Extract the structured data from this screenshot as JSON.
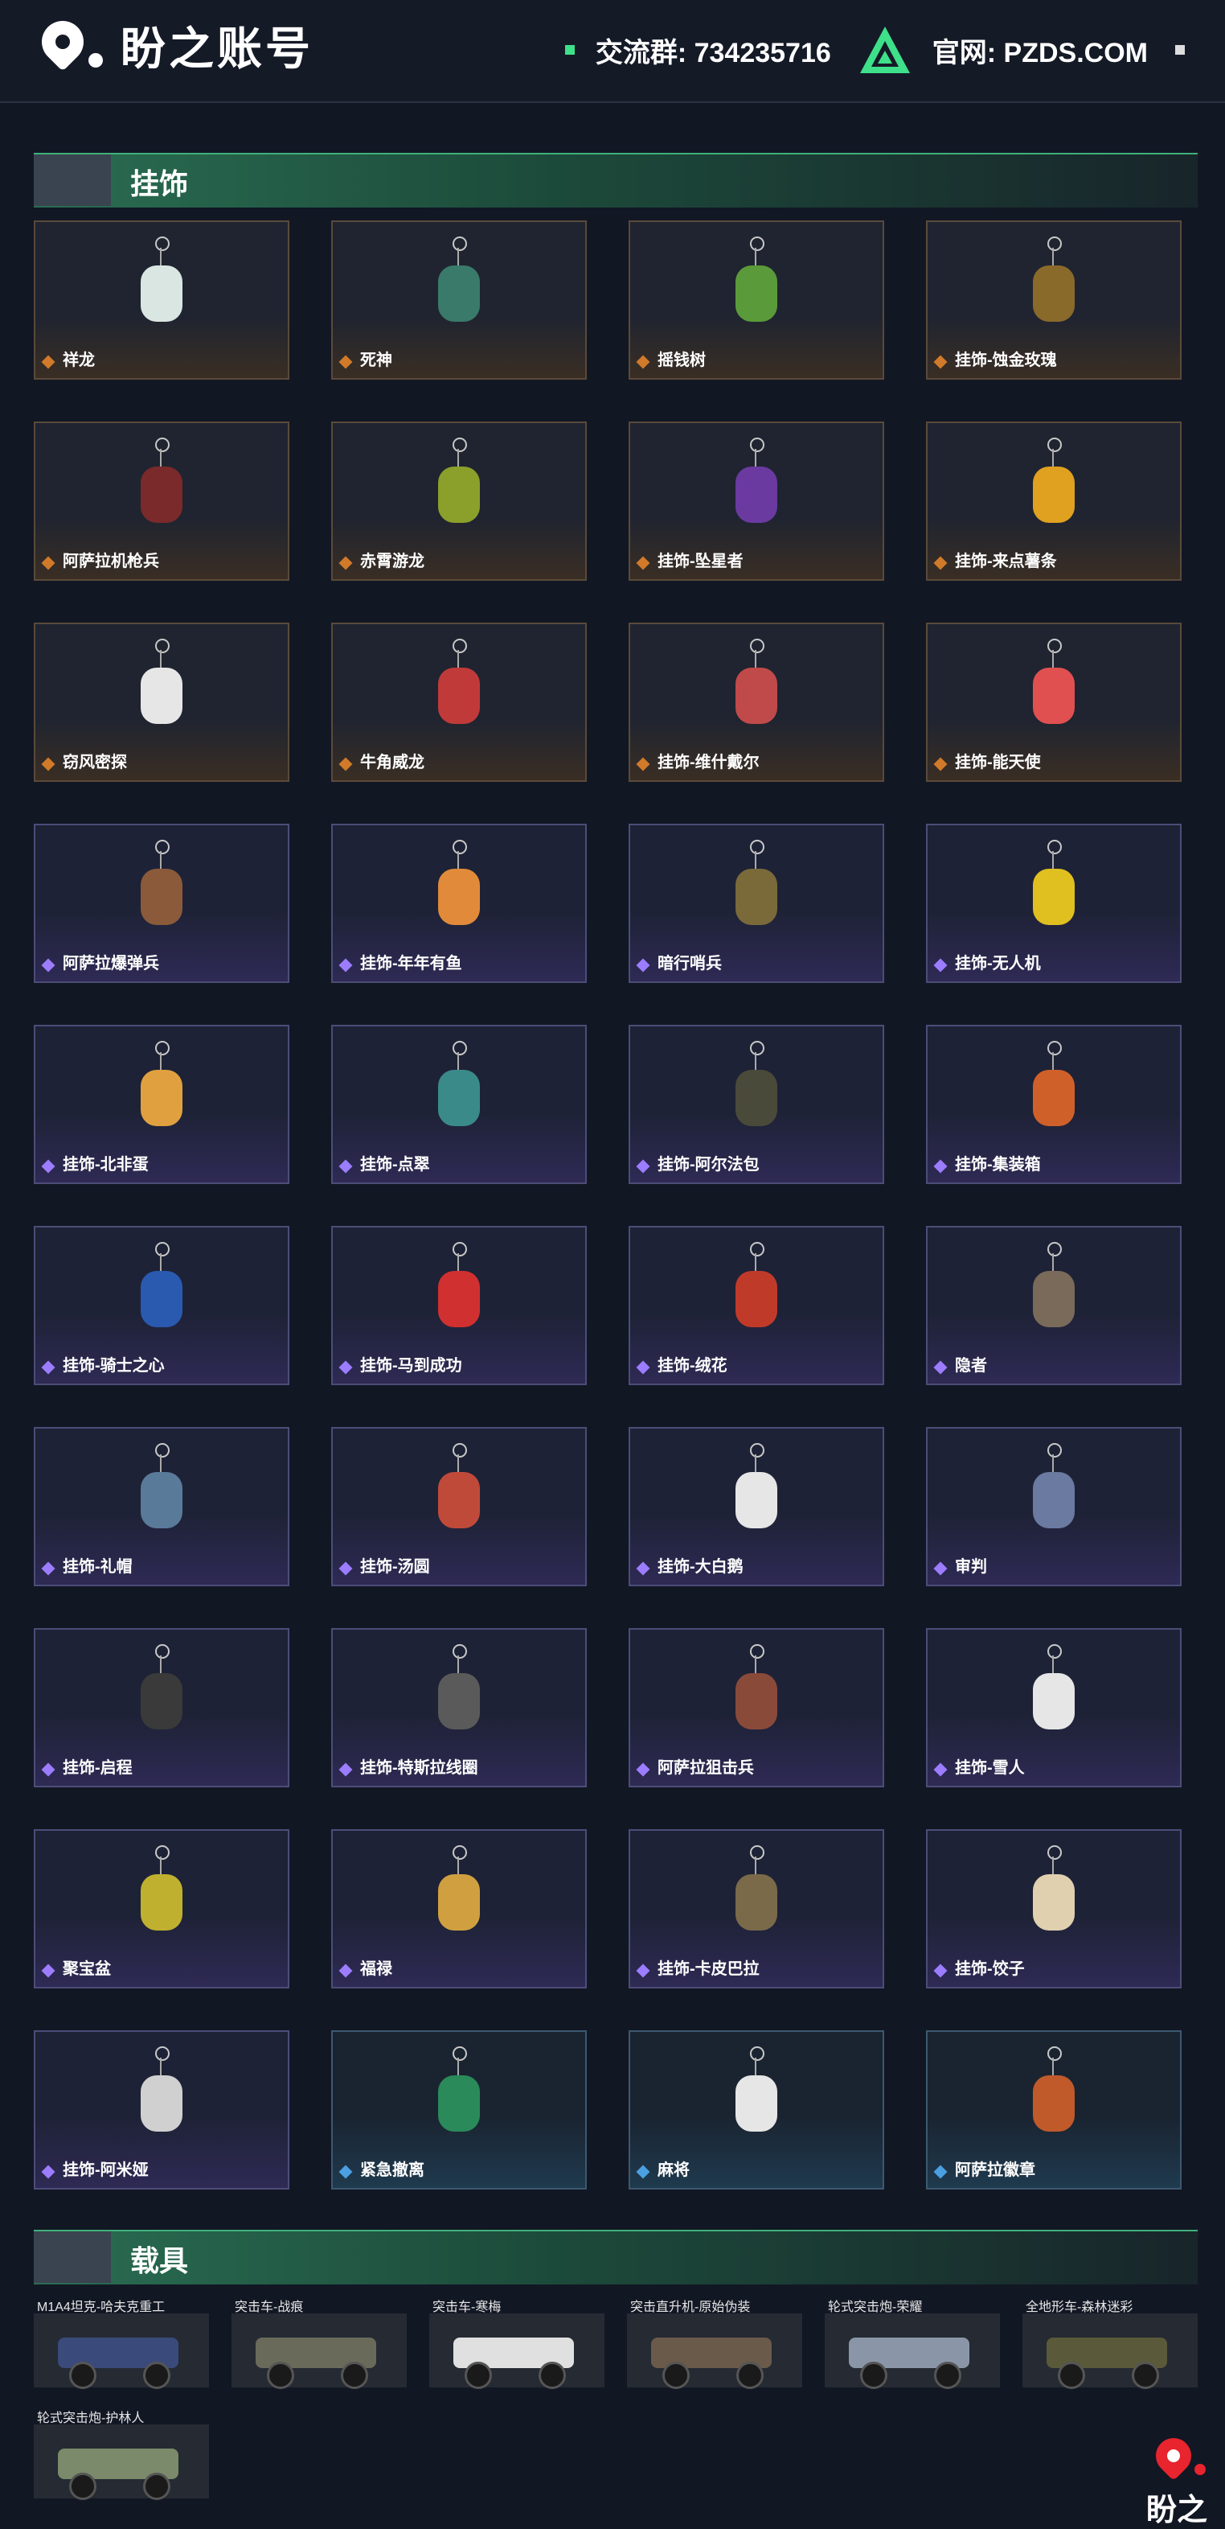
{
  "header": {
    "brand": "盼之账号",
    "group_label": "交流群: 734235716",
    "site_label": "官网: PZDS.COM"
  },
  "sections": {
    "charms_title": "挂饰",
    "vehicles_title": "载具"
  },
  "charms": [
    {
      "name": "祥龙",
      "rarity": "gold",
      "color": "#d9e6e2"
    },
    {
      "name": "死神",
      "rarity": "gold",
      "color": "#3a7a6a"
    },
    {
      "name": "摇钱树",
      "rarity": "gold",
      "color": "#5a9a3a"
    },
    {
      "name": "挂饰-蚀金玫瑰",
      "rarity": "gold",
      "color": "#8a6a2a"
    },
    {
      "name": "阿萨拉机枪兵",
      "rarity": "gold",
      "color": "#7a2a2a"
    },
    {
      "name": "赤霄游龙",
      "rarity": "gold",
      "color": "#8aa02a"
    },
    {
      "name": "挂饰-坠星者",
      "rarity": "gold",
      "color": "#6a3aa0"
    },
    {
      "name": "挂饰-来点薯条",
      "rarity": "gold",
      "color": "#e0a020"
    },
    {
      "name": "窃风密探",
      "rarity": "gold",
      "color": "#e6e6e6"
    },
    {
      "name": "牛角威龙",
      "rarity": "gold",
      "color": "#c03a3a"
    },
    {
      "name": "挂饰-维什戴尔",
      "rarity": "gold",
      "color": "#c04a4a"
    },
    {
      "name": "挂饰-能天使",
      "rarity": "gold",
      "color": "#e05050"
    },
    {
      "name": "阿萨拉爆弹兵",
      "rarity": "purple",
      "color": "#8a5a3a"
    },
    {
      "name": "挂饰-年年有鱼",
      "rarity": "purple",
      "color": "#e08a3a"
    },
    {
      "name": "暗行哨兵",
      "rarity": "purple",
      "color": "#7a6a3a"
    },
    {
      "name": "挂饰-无人机",
      "rarity": "purple",
      "color": "#e0c020"
    },
    {
      "name": "挂饰-北非蛋",
      "rarity": "purple",
      "color": "#e0a040"
    },
    {
      "name": "挂饰-点翠",
      "rarity": "purple",
      "color": "#3a8a8a"
    },
    {
      "name": "挂饰-阿尔法包",
      "rarity": "purple",
      "color": "#4a4a3a"
    },
    {
      "name": "挂饰-集装箱",
      "rarity": "purple",
      "color": "#d0602a"
    },
    {
      "name": "挂饰-骑士之心",
      "rarity": "purple",
      "color": "#2a5ab0"
    },
    {
      "name": "挂饰-马到成功",
      "rarity": "purple",
      "color": "#d03030"
    },
    {
      "name": "挂饰-绒花",
      "rarity": "purple",
      "color": "#c03a2a"
    },
    {
      "name": "隐者",
      "rarity": "purple",
      "color": "#7a6a5a"
    },
    {
      "name": "挂饰-礼帽",
      "rarity": "purple",
      "color": "#5a7a9a"
    },
    {
      "name": "挂饰-汤圆",
      "rarity": "purple",
      "color": "#c04a3a"
    },
    {
      "name": "挂饰-大白鹅",
      "rarity": "purple",
      "color": "#e6e6e6"
    },
    {
      "name": "审判",
      "rarity": "purple",
      "color": "#6a7aa0"
    },
    {
      "name": "挂饰-启程",
      "rarity": "purple",
      "color": "#3a3a3a"
    },
    {
      "name": "挂饰-特斯拉线圈",
      "rarity": "purple",
      "color": "#5a5a5a"
    },
    {
      "name": "阿萨拉狙击兵",
      "rarity": "purple",
      "color": "#8a4a3a"
    },
    {
      "name": "挂饰-雪人",
      "rarity": "purple",
      "color": "#e6e6e6"
    },
    {
      "name": "聚宝盆",
      "rarity": "purple",
      "color": "#c0b030"
    },
    {
      "name": "福禄",
      "rarity": "purple",
      "color": "#d0a040"
    },
    {
      "name": "挂饰-卡皮巴拉",
      "rarity": "purple",
      "color": "#7a6a4a"
    },
    {
      "name": "挂饰-饺子",
      "rarity": "purple",
      "color": "#e0d0b0"
    },
    {
      "name": "挂饰-阿米娅",
      "rarity": "purple",
      "color": "#d0d0d0"
    },
    {
      "name": "紧急撤离",
      "rarity": "blue",
      "color": "#2a8a5a"
    },
    {
      "name": "麻将",
      "rarity": "blue",
      "color": "#e6e6e6"
    },
    {
      "name": "阿萨拉徽章",
      "rarity": "blue",
      "color": "#c05a2a"
    }
  ],
  "vehicles": [
    {
      "name": "M1A4坦克-哈夫克重工",
      "color": "#3a4a7a"
    },
    {
      "name": "突击车-战痕",
      "color": "#6a6a5a"
    },
    {
      "name": "突击车-寒梅",
      "color": "#e0e0e0"
    },
    {
      "name": "突击直升机-原始伪装",
      "color": "#6a5a4a"
    },
    {
      "name": "轮式突击炮-荣耀",
      "color": "#8a96a8"
    },
    {
      "name": "全地形车-森林迷彩",
      "color": "#5a5a3a"
    },
    {
      "name": "轮式突击炮-护林人",
      "color": "#7a8a6a"
    }
  ],
  "watermark": "盼之"
}
